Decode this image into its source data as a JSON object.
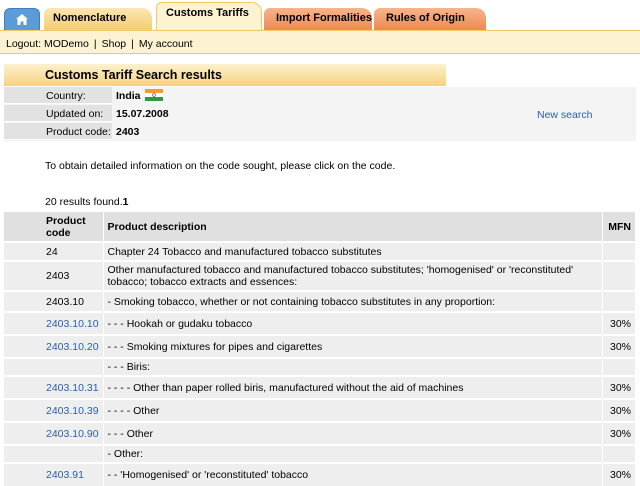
{
  "tabs": {
    "home_icon": "house-icon",
    "items": [
      "Nomenclature",
      "Customs Tariffs",
      "Import Formalities",
      "Rules of Origin"
    ]
  },
  "userbar": {
    "logout": "Logout: MODemo",
    "shop": "Shop",
    "account": "My account"
  },
  "title": "Customs Tariff Search results",
  "info": {
    "country_label": "Country:",
    "country_value": "India",
    "updated_label": "Updated on:",
    "updated_value": "15.07.2008",
    "code_label": "Product code:",
    "code_value": "2403",
    "new_search": "New search"
  },
  "instructions": "To obtain detailed information on the code sought, please click on the code.",
  "results_count_prefix": "20 results found.",
  "results_count_page": "1",
  "table": {
    "headers": [
      "Product code",
      "Product description",
      "MFN"
    ],
    "rows": [
      {
        "code": "24",
        "desc": "Chapter 24 Tobacco and manufactured tobacco substitutes",
        "mfn": "",
        "link": false
      },
      {
        "code": "2403",
        "desc": "Other manufactured tobacco and manufactured tobacco substitutes; 'homogenised' or 'reconstituted' tobacco; tobacco extracts and essences:",
        "mfn": "",
        "link": false
      },
      {
        "code": "2403.10",
        "desc": "- Smoking tobacco, whether or not containing tobacco substitutes in any proportion:",
        "mfn": "",
        "link": false
      },
      {
        "code": "2403.10.10",
        "desc": "- - - Hookah or gudaku tobacco",
        "mfn": "30%",
        "link": true
      },
      {
        "code": "2403.10.20",
        "desc": "- - - Smoking mixtures for pipes and cigarettes",
        "mfn": "30%",
        "link": true
      },
      {
        "code": "",
        "desc": "- - - Biris:",
        "mfn": "",
        "link": false
      },
      {
        "code": "2403.10.31",
        "desc": "- - - - Other than paper rolled biris, manufactured without the aid of machines",
        "mfn": "30%",
        "link": true
      },
      {
        "code": "2403.10.39",
        "desc": "- - - - Other",
        "mfn": "30%",
        "link": true
      },
      {
        "code": "2403.10.90",
        "desc": "- - - Other",
        "mfn": "30%",
        "link": true
      },
      {
        "code": "",
        "desc": "- Other:",
        "mfn": "",
        "link": false
      },
      {
        "code": "2403.91",
        "desc": "- - 'Homogenised' or 'reconstituted' tobacco",
        "mfn": "30%",
        "link": true
      }
    ]
  },
  "colors": {
    "link": "#2b5fa8",
    "tab_active": "#fdf2d2",
    "tab_orange": "#ee8a52",
    "title_gradient": "#f6d27c"
  }
}
